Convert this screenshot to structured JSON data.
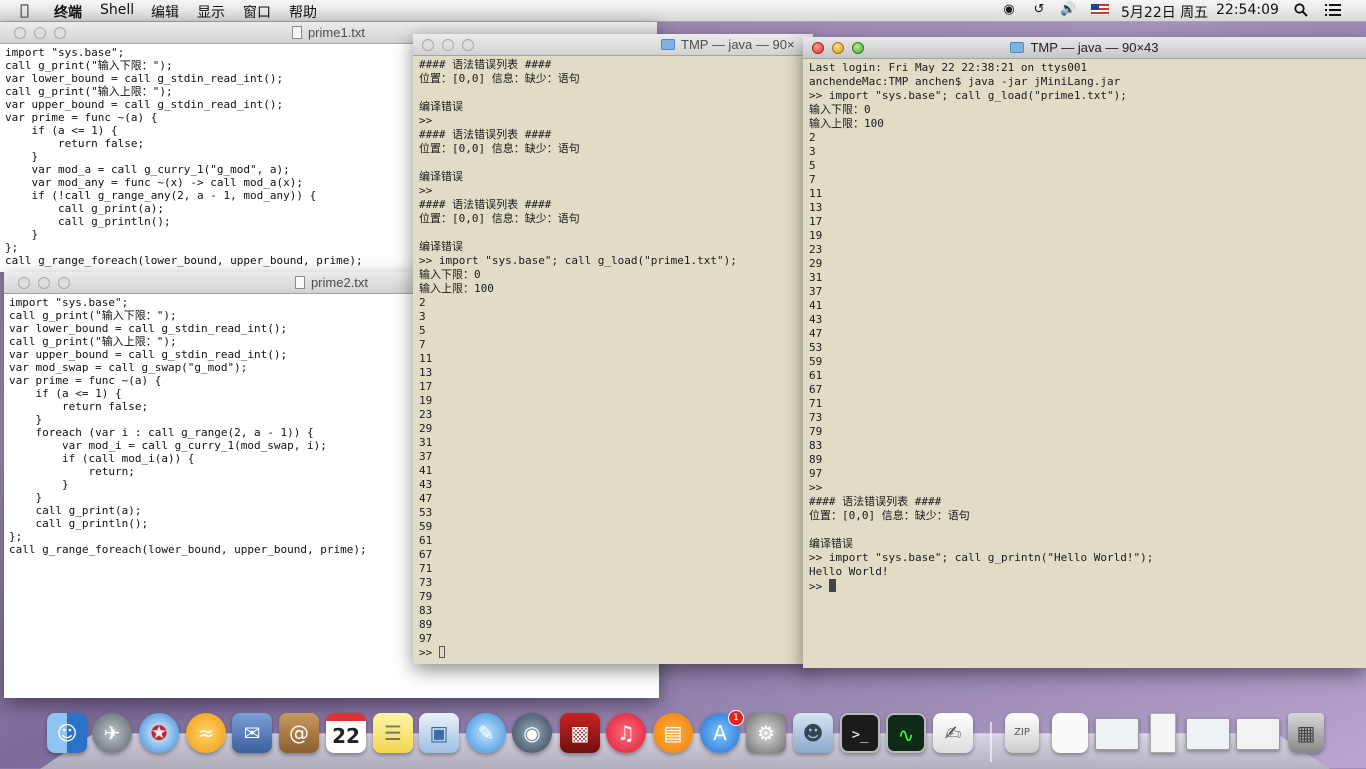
{
  "menubar": {
    "apple": "",
    "items": [
      "终端",
      "Shell",
      "编辑",
      "显示",
      "窗口",
      "帮助"
    ],
    "date": "5月22日 周五",
    "time": "22:54:09",
    "status_icons": [
      "wifi-icon",
      "time-machine-icon",
      "volume-icon",
      "flag-icon",
      "search-icon",
      "list-icon"
    ]
  },
  "prime1": {
    "title": "prime1.txt",
    "code": "import \"sys.base\";\ncall g_print(\"输入下限：\");\nvar lower_bound = call g_stdin_read_int();\ncall g_print(\"输入上限：\");\nvar upper_bound = call g_stdin_read_int();\nvar prime = func ~(a) {\n    if (a <= 1) {\n        return false;\n    }\n    var mod_a = call g_curry_1(\"g_mod\", a);\n    var mod_any = func ~(x) -> call mod_a(x);\n    if (!call g_range_any(2, a - 1, mod_any)) {\n        call g_print(a);\n        call g_println();\n    }\n};\ncall g_range_foreach(lower_bound, upper_bound, prime);"
  },
  "prime2": {
    "title": "prime2.txt",
    "code": "import \"sys.base\";\ncall g_print(\"输入下限：\");\nvar lower_bound = call g_stdin_read_int();\ncall g_print(\"输入上限：\");\nvar upper_bound = call g_stdin_read_int();\nvar mod_swap = call g_swap(\"g_mod\");\nvar prime = func ~(a) {\n    if (a <= 1) {\n        return false;\n    }\n    foreach (var i : call g_range(2, a - 1)) {\n        var mod_i = call g_curry_1(mod_swap, i);\n        if (call mod_i(a)) {\n            return;\n        }\n    }\n    call g_print(a);\n    call g_println();\n};\ncall g_range_foreach(lower_bound, upper_bound, prime);"
  },
  "term_back": {
    "title": "TMP — java — 90×",
    "output": "#### 语法错误列表 ####\n位置：[0,0] 信息：缺少：语句\n\n编译错误\n>>\n#### 语法错误列表 ####\n位置：[0,0] 信息：缺少：语句\n\n编译错误\n>>\n#### 语法错误列表 ####\n位置：[0,0] 信息：缺少：语句\n\n编译错误\n>> import \"sys.base\"; call g_load(\"prime1.txt\");\n输入下限：0\n输入上限：100\n2\n3\n5\n7\n11\n13\n17\n19\n23\n29\n31\n37\n41\n43\n47\n53\n59\n61\n67\n71\n73\n79\n83\n89\n97",
    "prompt": ">> "
  },
  "term_front": {
    "title": "TMP — java — 90×43",
    "output": "Last login: Fri May 22 22:38:21 on ttys001\nanchendeMac:TMP anchen$ java -jar jMiniLang.jar\n>> import \"sys.base\"; call g_load(\"prime1.txt\");\n输入下限：0\n输入上限：100\n2\n3\n5\n7\n11\n13\n17\n19\n23\n29\n31\n37\n41\n43\n47\n53\n59\n61\n67\n71\n73\n79\n83\n89\n97\n>>\n#### 语法错误列表 ####\n位置：[0,0] 信息：缺少：语句\n\n编译错误\n>> import \"sys.base\"; call g_printn(\"Hello World!\");\nHello World!",
    "prompt": ">> "
  },
  "dock": {
    "app_store_badge": "1",
    "calendar_day": "22",
    "icons": [
      "finder-icon",
      "launchpad-icon",
      "safari-icon",
      "app-icon",
      "mail-icon",
      "contacts-icon",
      "calendar-icon",
      "notes-icon",
      "preview-icon",
      "messages-icon",
      "facetime-icon",
      "photo-booth-icon",
      "itunes-icon",
      "ibooks-icon",
      "app-store-icon",
      "system-preferences-icon",
      "photo-icon",
      "terminal-icon",
      "activity-monitor-icon",
      "textedit-icon",
      "archive-icon",
      "document-icon",
      "window-thumbnail-icon",
      "window-thumbnail-icon",
      "window-thumbnail-icon",
      "window-thumbnail-icon",
      "downloads-icon",
      "trash-icon"
    ]
  }
}
